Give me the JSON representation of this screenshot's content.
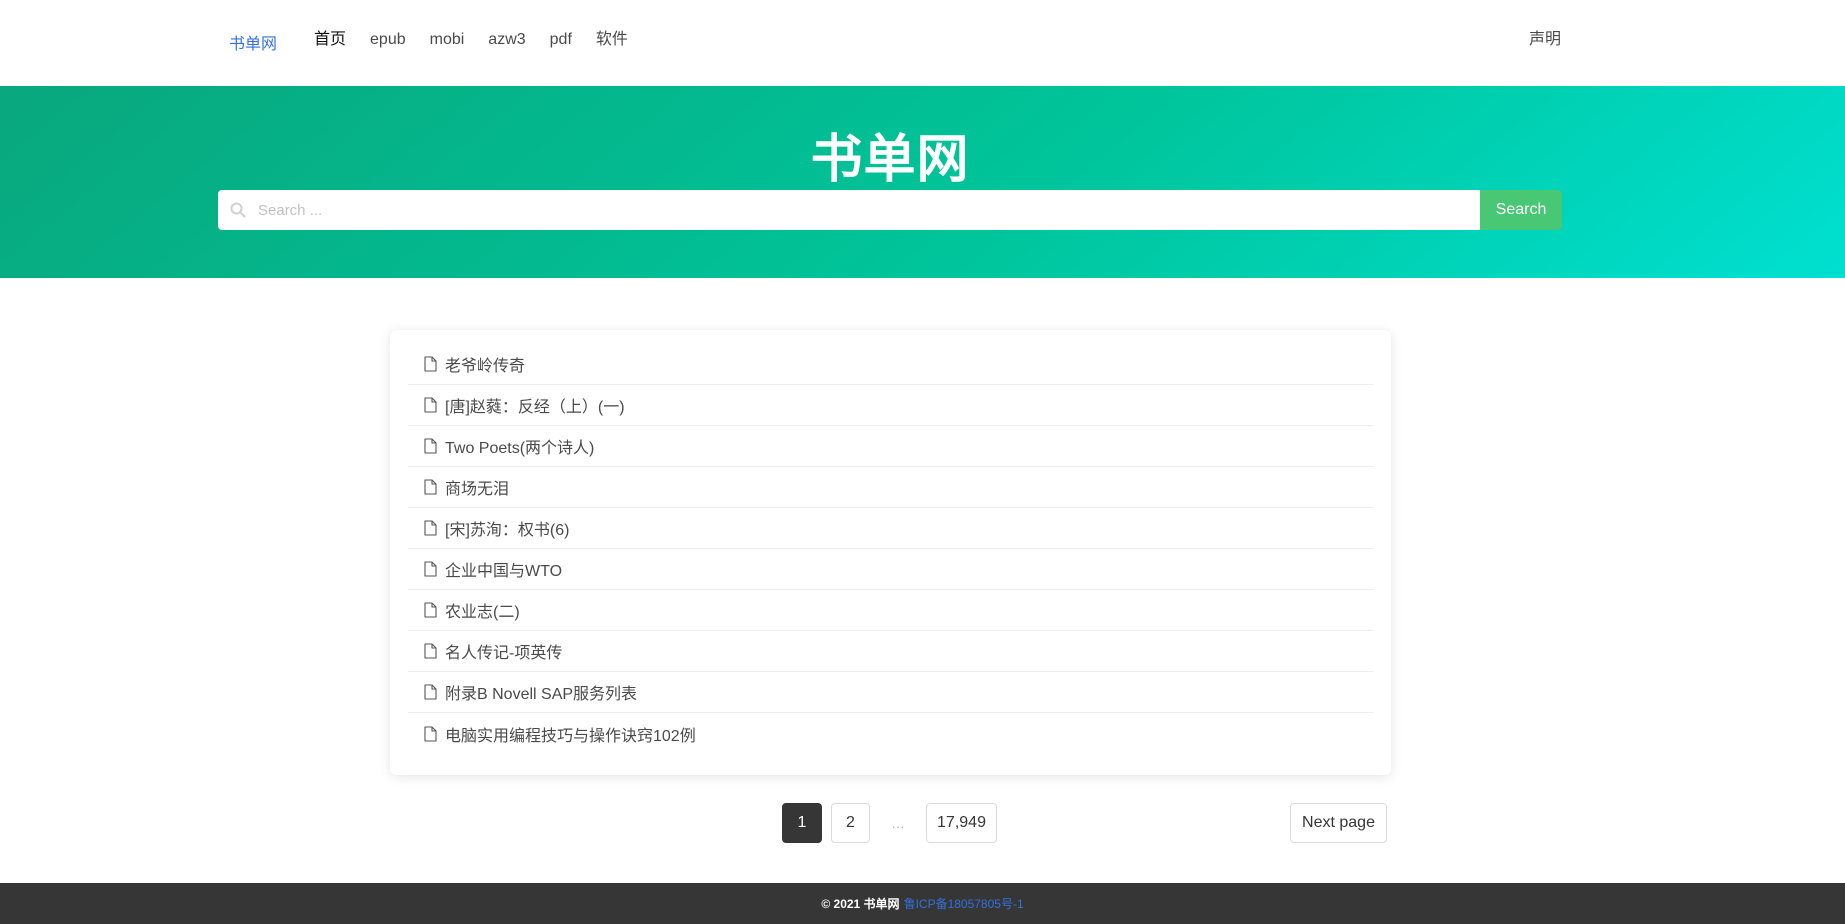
{
  "navbar": {
    "brand": "书单网",
    "links": [
      {
        "label": "首页"
      },
      {
        "label": "epub"
      },
      {
        "label": "mobi"
      },
      {
        "label": "azw3"
      },
      {
        "label": "pdf"
      },
      {
        "label": "软件"
      }
    ],
    "right_link": "声明"
  },
  "hero": {
    "title": "书单网",
    "search": {
      "placeholder": "Search ...",
      "value": "",
      "button_label": "Search",
      "icon": "search-icon"
    }
  },
  "book_list": {
    "item_icon": "file-icon",
    "items": [
      {
        "title": "老爷岭传奇"
      },
      {
        "title": "[唐]赵蕤：反经（上）(一)"
      },
      {
        "title": "Two Poets(两个诗人)"
      },
      {
        "title": "商场无泪"
      },
      {
        "title": "[宋]苏洵：权书(6)"
      },
      {
        "title": "企业中国与WTO"
      },
      {
        "title": "农业志(二)"
      },
      {
        "title": "名人传记-项英传"
      },
      {
        "title": "附录B Novell SAP服务列表"
      },
      {
        "title": "电脑实用编程技巧与操作诀窍102例"
      }
    ]
  },
  "pagination": {
    "current": "1",
    "next_page": "2",
    "ellipsis": "…",
    "last_page": "17,949",
    "next_label": "Next page"
  },
  "footer": {
    "copyright": "© 2021 书单网",
    "icp": "鲁ICP备18057805号-1"
  },
  "colors": {
    "brand_link": "#3273dc",
    "search_button": "#48c774",
    "hero_gradient_start": "#09a77d",
    "hero_gradient_end": "#00e0d1",
    "footer_bg": "#363636",
    "current_page_bg": "#363636"
  }
}
